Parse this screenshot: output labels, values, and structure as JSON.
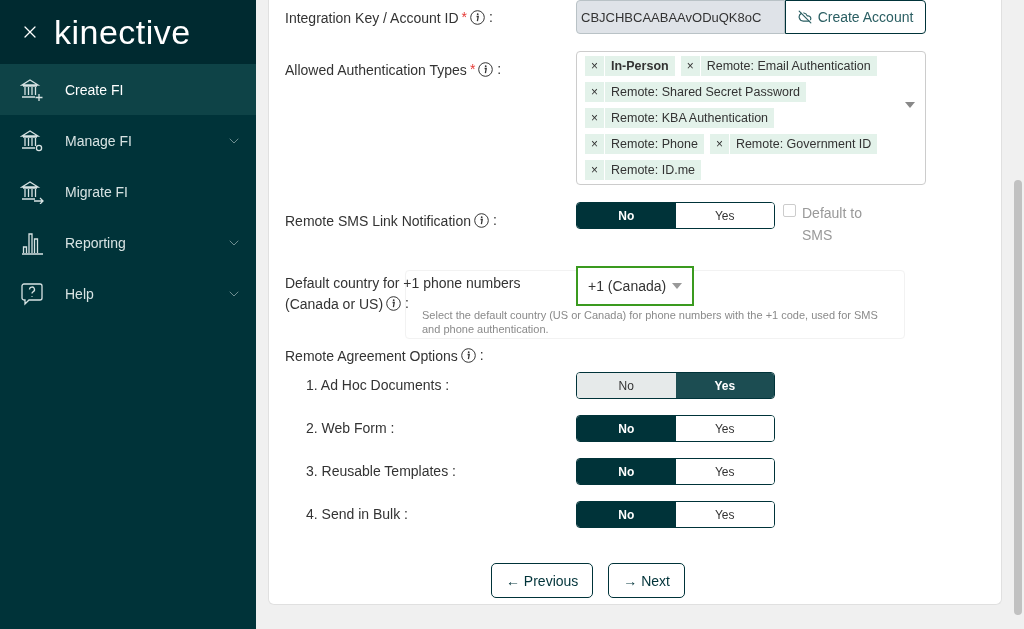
{
  "sidebar": {
    "logo": "kinective",
    "items": [
      {
        "label": "Create FI",
        "selected": true,
        "expandable": false
      },
      {
        "label": "Manage FI",
        "selected": false,
        "expandable": true
      },
      {
        "label": "Migrate FI",
        "selected": false,
        "expandable": false
      },
      {
        "label": "Reporting",
        "selected": false,
        "expandable": true
      },
      {
        "label": "Help",
        "selected": false,
        "expandable": true
      }
    ]
  },
  "form": {
    "integration_key": {
      "label": "Integration Key / Account ID",
      "required_mark": "*",
      "colon": ":",
      "value": "CBJCHBCAABAAvODuQK8oC",
      "button": "Create Account"
    },
    "auth_types": {
      "label": "Allowed Authentication Types",
      "required_mark": "*",
      "colon": ":",
      "remove_mark": "×",
      "tags": [
        {
          "label": "In-Person",
          "emphasized": true
        },
        {
          "label": "Remote: Email Authentication",
          "emphasized": false
        },
        {
          "label": "Remote: Shared Secret Password",
          "emphasized": false
        },
        {
          "label": "Remote: KBA Authentication",
          "emphasized": false
        },
        {
          "label": "Remote: Phone",
          "emphasized": false
        },
        {
          "label": "Remote: Government ID",
          "emphasized": false
        },
        {
          "label": "Remote: ID.me",
          "emphasized": false
        }
      ]
    },
    "sms": {
      "label": "Remote SMS Link Notification",
      "colon": ":",
      "options": [
        {
          "label": "No",
          "selected": true
        },
        {
          "label": "Yes",
          "selected": false
        }
      ],
      "checkbox": {
        "label": "Default to SMS",
        "checked": false,
        "disabled": true
      }
    },
    "country": {
      "label_lines": [
        "Default country for +1 phone numbers",
        "(Canada or US)"
      ],
      "colon": ":",
      "value": "+1 (Canada)",
      "focused": true,
      "tooltip": "Select the default country (US or Canada) for phone numbers with the +1 code, used for SMS and phone authentication."
    },
    "agreement": {
      "label": "Remote Agreement Options",
      "colon": ":",
      "rows": [
        {
          "label": "1. Ad Hoc Documents :",
          "focused": true,
          "options": [
            {
              "label": "No",
              "selected": false
            },
            {
              "label": "Yes",
              "selected": true
            }
          ]
        },
        {
          "label": "2. Web Form :",
          "focused": false,
          "options": [
            {
              "label": "No",
              "selected": true
            },
            {
              "label": "Yes",
              "selected": false
            }
          ]
        },
        {
          "label": "3. Reusable Templates :",
          "focused": false,
          "options": [
            {
              "label": "No",
              "selected": true
            },
            {
              "label": "Yes",
              "selected": false
            }
          ]
        },
        {
          "label": "4. Send in Bulk :",
          "focused": false,
          "options": [
            {
              "label": "No",
              "selected": true
            },
            {
              "label": "Yes",
              "selected": false
            }
          ]
        }
      ]
    }
  },
  "navigation": {
    "previous": "← Previous",
    "next": "→ Next"
  }
}
